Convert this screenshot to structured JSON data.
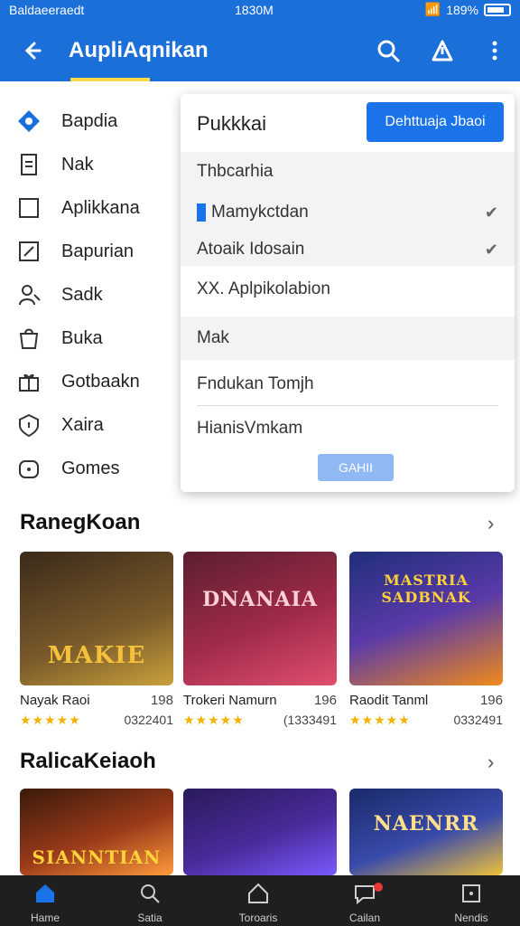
{
  "status": {
    "left_text": "Baldaeeraedt",
    "time": "1830M",
    "battery": "189%"
  },
  "appbar": {
    "title": "AupliAqnikan",
    "icons": [
      "back-arrow-icon",
      "search-icon",
      "share-icon",
      "more-icon"
    ]
  },
  "menu": {
    "items": [
      {
        "label": "Bapdia",
        "icon": "diamond-icon"
      },
      {
        "label": "Nak",
        "icon": "file-icon"
      },
      {
        "label": "Aplikkana",
        "icon": "square-icon"
      },
      {
        "label": "Bapurian",
        "icon": "edit-icon"
      },
      {
        "label": "Sadk",
        "icon": "person-icon"
      },
      {
        "label": "Buka",
        "icon": "bag-icon"
      },
      {
        "label": "Gotbaakn",
        "icon": "gift-icon"
      },
      {
        "label": "Xaira",
        "icon": "shield-icon"
      },
      {
        "label": "Gomes",
        "icon": "gamepad-icon"
      }
    ]
  },
  "popup": {
    "title": "Pukkkai",
    "primary_button": "Dehttuaja Jbaoi",
    "rows": [
      {
        "label": "Thbcarhia"
      },
      {
        "label": "Mamykctdan"
      },
      {
        "label": "Atoaik Idosain"
      },
      {
        "label": "XX. Aplpikolabion"
      },
      {
        "label": "Mak"
      },
      {
        "label": "Fndukan Tomjh"
      },
      {
        "label": "HianisVmkam"
      }
    ],
    "apply_button": "GAHII"
  },
  "sections": [
    {
      "title": "RanegKoan",
      "cards": [
        {
          "name": "Nayak Raoi",
          "value": "198",
          "count": "0322401",
          "art_text": "MAKIE",
          "colors": [
            "#3a2a1a",
            "#c9a13b"
          ]
        },
        {
          "name": "Trokeri Namurn",
          "value": "196",
          "count": "(1333491",
          "art_text": "DNANAIA",
          "colors": [
            "#5b1f2e",
            "#e04f6e"
          ]
        },
        {
          "name": "Raodit Tanml",
          "value": "196",
          "count": "0332491",
          "art_text": "MASTRIA SADBNAK",
          "colors": [
            "#1f2f7a",
            "#f08a1a"
          ]
        }
      ]
    },
    {
      "title": "RalicaKeiaoh",
      "cards": [
        {
          "name": "",
          "value": "",
          "count": "",
          "art_text": "SIANNTIAN",
          "colors": [
            "#3a1a0a",
            "#ff9a3a"
          ]
        },
        {
          "name": "",
          "value": "",
          "count": "",
          "art_text": "",
          "colors": [
            "#2a1a5a",
            "#7a5aff"
          ]
        },
        {
          "name": "",
          "value": "",
          "count": "",
          "art_text": "NAENRR",
          "colors": [
            "#1a2a6a",
            "#f0c23a"
          ]
        }
      ]
    }
  ],
  "bottom_nav": [
    {
      "label": "Hame",
      "icon": "home-icon"
    },
    {
      "label": "Satia",
      "icon": "search-icon"
    },
    {
      "label": "Toroaris",
      "icon": "tag-icon"
    },
    {
      "label": "Cailan",
      "icon": "chat-icon"
    },
    {
      "label": "Nendis",
      "icon": "square-icon"
    }
  ]
}
